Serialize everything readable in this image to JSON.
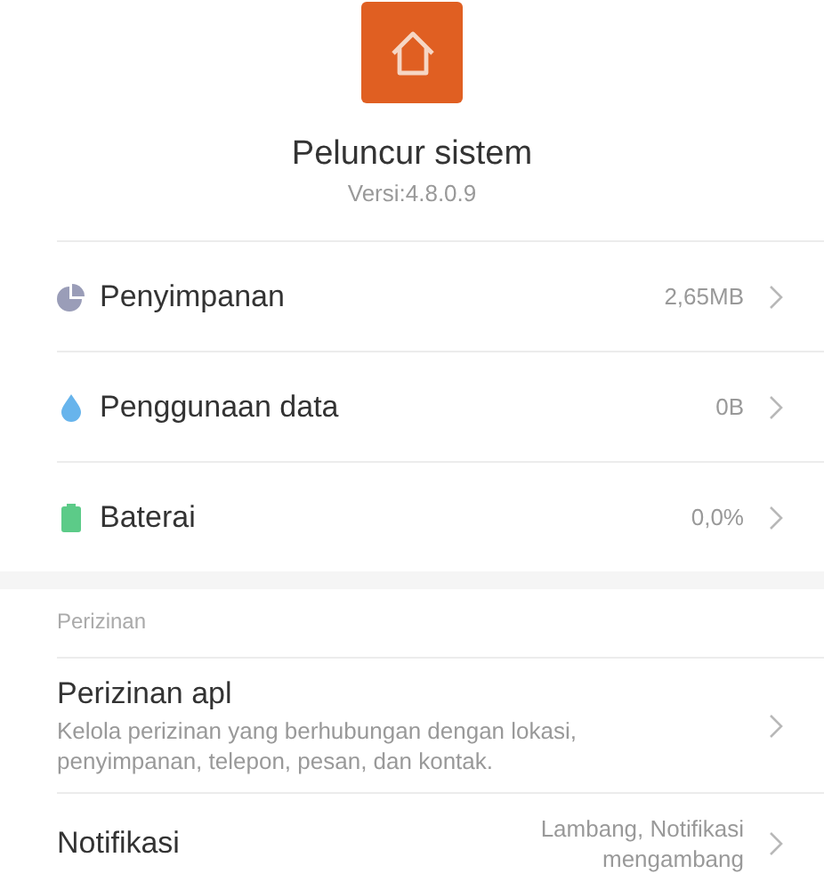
{
  "app": {
    "name": "Peluncur sistem",
    "version": "Versi:4.8.0.9"
  },
  "usage": [
    {
      "kind": "storage",
      "label": "Penyimpanan",
      "value": "2,65MB"
    },
    {
      "kind": "data",
      "label": "Penggunaan data",
      "value": "0B"
    },
    {
      "kind": "battery",
      "label": "Baterai",
      "value": "0,0%"
    }
  ],
  "permissions": {
    "header": "Perizinan",
    "items": [
      {
        "title": "Perizinan apl",
        "description": "Kelola perizinan yang berhubungan dengan lokasi, penyimpanan, telepon, pesan, dan kontak."
      },
      {
        "title": "Notifikasi",
        "value": "Lambang, Notifikasi mengambang"
      }
    ]
  }
}
